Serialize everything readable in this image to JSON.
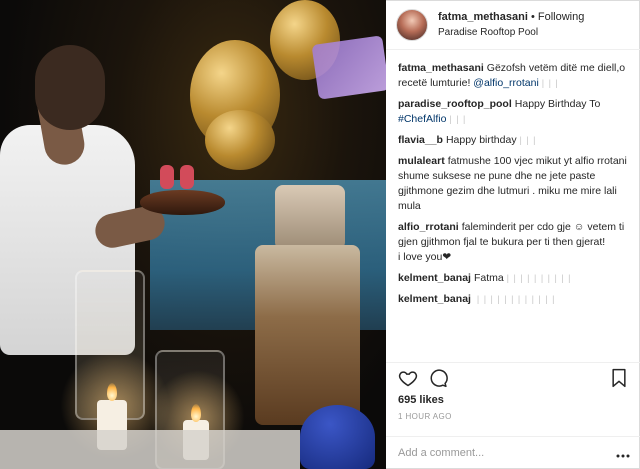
{
  "header": {
    "username": "fatma_methasani",
    "separator": "•",
    "follow_status": "Following",
    "location": "Paradise Rooftop Pool"
  },
  "comments": [
    {
      "user": "fatma_methasani",
      "text": "Gëzofsh vetëm ditë me diell,o recetë lumturie! ",
      "mention": "@alfio_rrotani",
      "reply": "| | |"
    },
    {
      "user": "paradise_rooftop_pool",
      "text": "Happy Birthday To ",
      "mention": "#ChefAlfio",
      "reply": "| | |"
    },
    {
      "user": "flavia__b",
      "text": "Happy birthday",
      "mention": "",
      "reply": "| | |"
    },
    {
      "user": "mulaleart",
      "text": "fatmushe 100 vjec mikut yt alfio rrotani shume suksese ne pune dhe ne jete paste gjithmone gezim dhe lutmuri . miku me mire lali mula",
      "mention": "",
      "reply": ""
    },
    {
      "user": "alfio_rrotani",
      "text": "faleminderit per cdo gje ☺ vetem ti gjen gjithmon fjal te bukura per ti then gjerat!",
      "text2": "i love you❤",
      "mention": "",
      "reply": "| | |"
    },
    {
      "user": "kelment_banaj",
      "text": "Fatma",
      "mention": "",
      "reply": "| | | | | | | | | |"
    },
    {
      "user": "kelment_banaj",
      "text": "",
      "mention": "",
      "reply": "| | | | | | | | | | | |"
    }
  ],
  "actions": {
    "like_icon": "heart-icon",
    "comment_icon": "comment-bubble-icon",
    "save_icon": "bookmark-icon"
  },
  "likes": "695 likes",
  "timestamp": "1 HOUR AGO",
  "add_comment_placeholder": "Add a comment...",
  "photo": {
    "description_alt": "Birthday celebration photo"
  },
  "colors": {
    "link": "#003569",
    "text": "#262626",
    "muted": "#999999",
    "border": "#efefef"
  }
}
